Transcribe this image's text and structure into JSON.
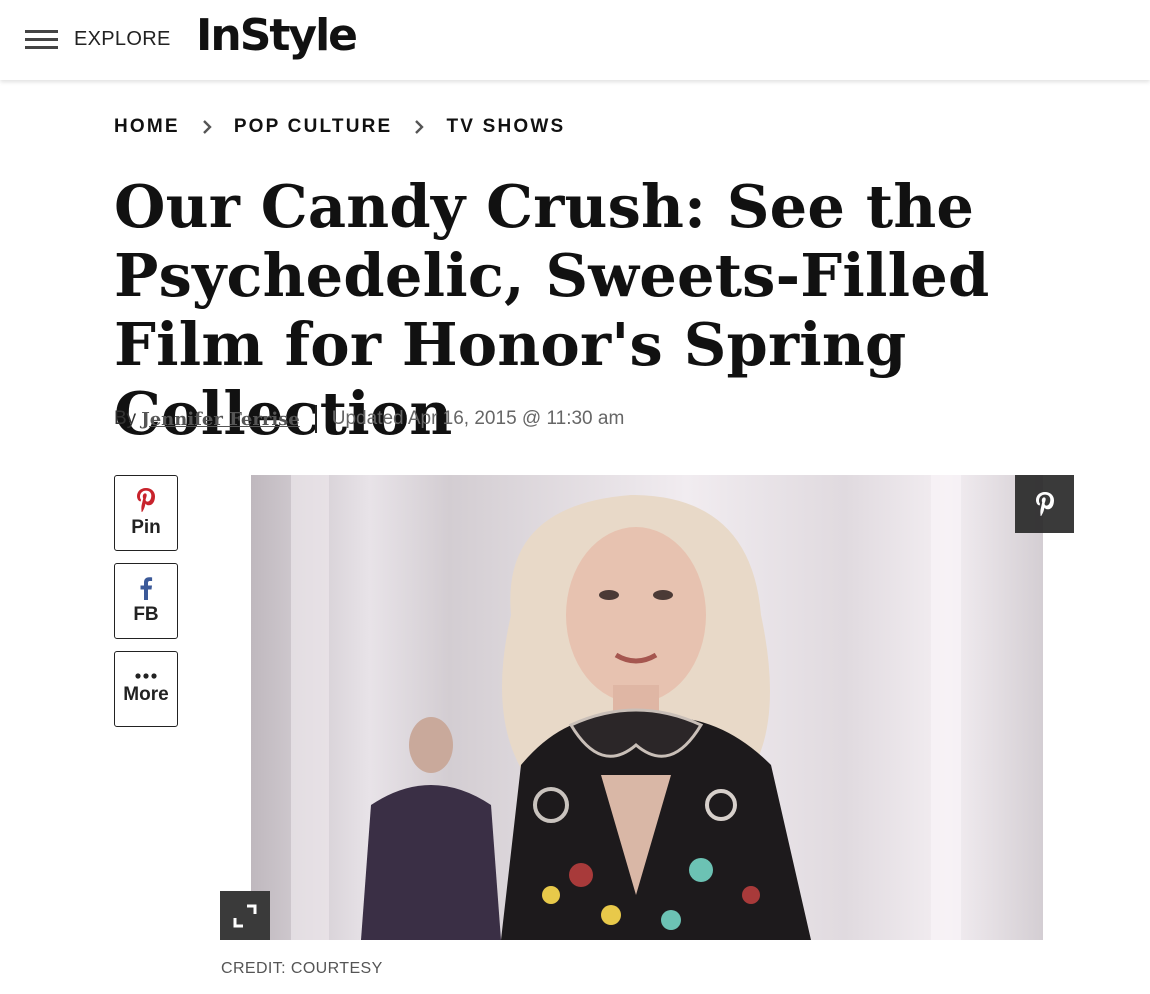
{
  "header": {
    "explore_label": "EXPLORE",
    "logo_text": "InStyle"
  },
  "breadcrumb": [
    {
      "label": "HOME"
    },
    {
      "label": "POP CULTURE"
    },
    {
      "label": "TV SHOWS"
    }
  ],
  "article": {
    "title": "Our Candy Crush: See the Psychedelic, Sweets-Filled Film for Honor's Spring Collection",
    "byline_prefix": "By",
    "author": "Jennifer Ferrise",
    "updated": "Updated Apr 16, 2015 @ 11:30 am"
  },
  "share": {
    "pin_label": "Pin",
    "fb_label": "FB",
    "more_label": "More"
  },
  "image": {
    "credit": "CREDIT: COURTESY"
  },
  "colors": {
    "pinterest": "#c8232c",
    "facebook": "#3b5998",
    "text": "#111111"
  }
}
